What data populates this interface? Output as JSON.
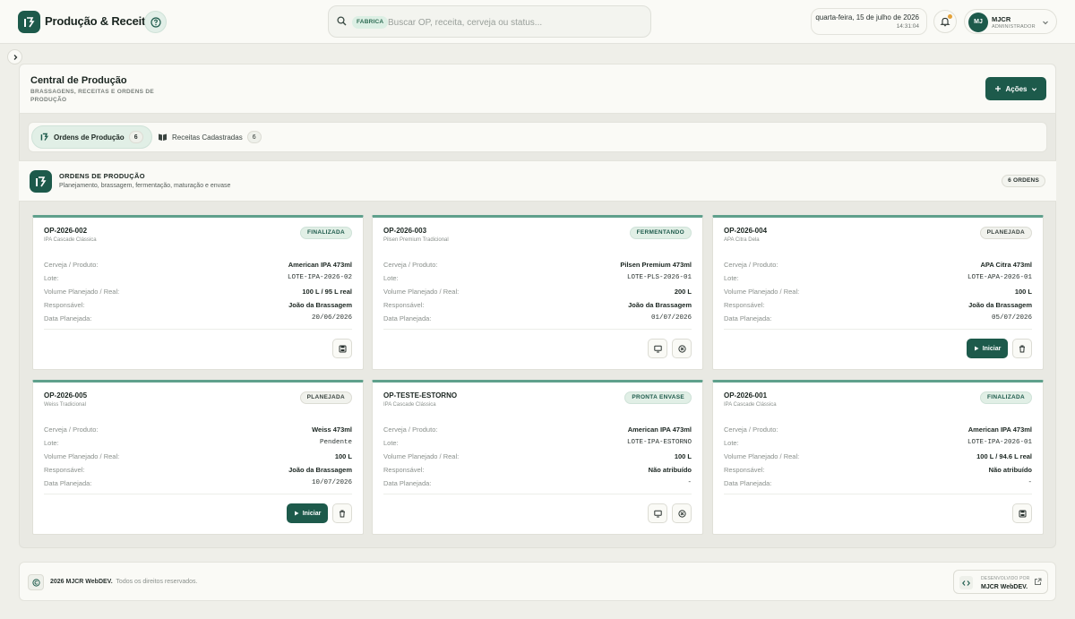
{
  "app": {
    "title": "Produção & Receitas"
  },
  "search": {
    "chip": "FABRICA",
    "placeholder": "Buscar OP, receita, cerveja ou status..."
  },
  "datetime": {
    "date": "quarta-feira, 15 de julho de 2026",
    "time": "14:31:04"
  },
  "user": {
    "initials": "MJ",
    "name": "MJCR",
    "role": "ADMINISTRADOR"
  },
  "header": {
    "title": "Central de Produção",
    "subtitle": "BRASSAGENS, RECEITAS E ORDENS DE PRODUÇÃO",
    "actions_label": "Ações"
  },
  "tabs": [
    {
      "label": "Ordens de Produção",
      "count": "6"
    },
    {
      "label": "Receitas Cadastradas",
      "count": "6"
    }
  ],
  "section": {
    "title": "ORDENS DE PRODUÇÃO",
    "subtitle": "Planejamento, brassagem, fermentação, maturação e envase",
    "badge": "6 ORDENS"
  },
  "field_labels": {
    "product": "Cerveja / Produto:",
    "lot": "Lote:",
    "volume": "Volume Planejado / Real:",
    "responsible": "Responsável:",
    "planned_date": "Data Planejada:"
  },
  "start_label": "Iniciar",
  "orders": [
    {
      "code": "OP-2026-002",
      "recipe": "IPA Cascade Clássica",
      "status": "FINALIZADA",
      "product": "American IPA 473ml",
      "lot": "LOTE-IPA-2026-02",
      "volume": "100 L / 95 L real",
      "responsible": "João da Brassagem",
      "planned_date": "20/06/2026"
    },
    {
      "code": "OP-2026-003",
      "recipe": "Pilsen Premium Tradicional",
      "status": "FERMENTANDO",
      "product": "Pilsen Premium 473ml",
      "lot": "LOTE-PLS-2026-01",
      "volume": "200 L",
      "responsible": "João da Brassagem",
      "planned_date": "01/07/2026"
    },
    {
      "code": "OP-2026-004",
      "recipe": "APA Citra Dela",
      "status": "PLANEJADA",
      "product": "APA Citra 473ml",
      "lot": "LOTE-APA-2026-01",
      "volume": "100 L",
      "responsible": "João da Brassagem",
      "planned_date": "05/07/2026"
    },
    {
      "code": "OP-2026-005",
      "recipe": "Weiss Tradicional",
      "status": "PLANEJADA",
      "product": "Weiss 473ml",
      "lot": "Pendente",
      "volume": "100 L",
      "responsible": "João da Brassagem",
      "planned_date": "10/07/2026"
    },
    {
      "code": "OP-TESTE-ESTORNO",
      "recipe": "IPA Cascade Clássica",
      "status": "PRONTA ENVASE",
      "product": "American IPA 473ml",
      "lot": "LOTE-IPA-ESTORNO",
      "volume": "100 L",
      "responsible": "Não atribuído",
      "planned_date": "-"
    },
    {
      "code": "OP-2026-001",
      "recipe": "IPA Cascade Clássica",
      "status": "FINALIZADA",
      "product": "American IPA 473ml",
      "lot": "LOTE-IPA-2026-01",
      "volume": "100 L / 94.6 L real",
      "responsible": "Não atribuído",
      "planned_date": "-"
    }
  ],
  "footer": {
    "copyright": "2026 MJCR WebDEV.",
    "rights": "Todos os direitos reservados.",
    "dev_label": "DESENVOLVIDO POR",
    "dev_name": "MJCR WebDEV."
  }
}
